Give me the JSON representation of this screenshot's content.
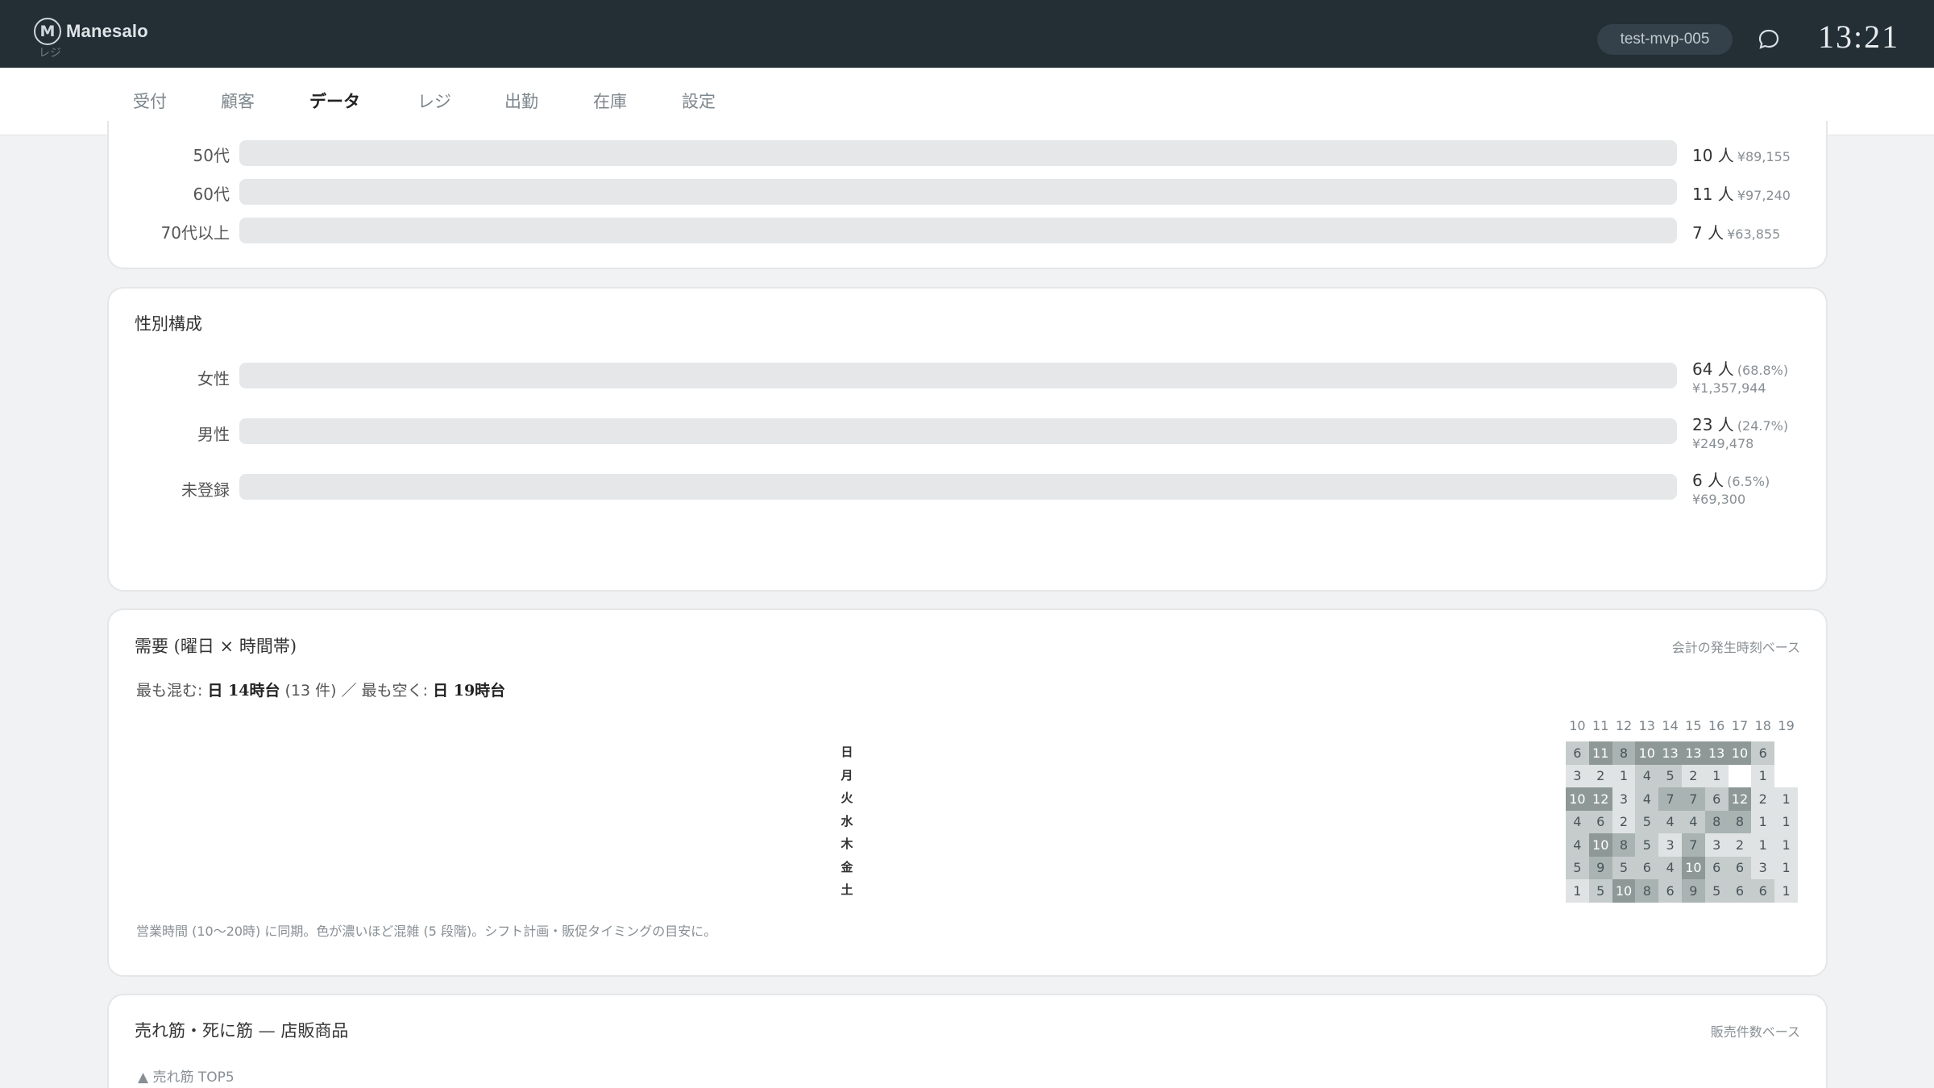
{
  "header": {
    "logo_glyph": "M",
    "app_name": "Manesalo",
    "app_sub": "レジ",
    "account": "test-mvp-005",
    "time": "13:21"
  },
  "tabs": [
    {
      "label": "受付"
    },
    {
      "label": "顧客"
    },
    {
      "label": "データ",
      "active": true
    },
    {
      "label": "レジ"
    },
    {
      "label": "出勤"
    },
    {
      "label": "在庫"
    },
    {
      "label": "設定"
    }
  ],
  "age": {
    "rows": [
      {
        "label": "50代",
        "count": "10 人",
        "amount": "¥89,155"
      },
      {
        "label": "60代",
        "count": "11 人",
        "amount": "¥97,240"
      },
      {
        "label": "70代以上",
        "count": "7 人",
        "amount": "¥63,855"
      }
    ]
  },
  "gender": {
    "title": "性別構成",
    "rows": [
      {
        "label": "女性",
        "count": "64 人",
        "pct": "(68.8%)",
        "amount": "¥1,357,944"
      },
      {
        "label": "男性",
        "count": "23 人",
        "pct": "(24.7%)",
        "amount": "¥249,478"
      },
      {
        "label": "未登録",
        "count": "6 人",
        "pct": "(6.5%)",
        "amount": "¥69,300"
      }
    ]
  },
  "demand": {
    "title": "需要 (曜日 × 時間帯)",
    "note": "会計の発生時刻ベース",
    "summary_busy_label": "最も混む: ",
    "summary_busy_value": "日 14時台",
    "summary_busy_count": " (13 件) ／ 最も空く: ",
    "summary_quiet_value": "日 19時台",
    "footnote": "営業時間 (10〜20時) に同期。色が濃いほど混雑 (5 段階)。シフト計画・販促タイミングの目安に。",
    "hours": [
      "10",
      "11",
      "12",
      "13",
      "14",
      "15",
      "16",
      "17",
      "18",
      "19"
    ],
    "days": [
      "日",
      "月",
      "火",
      "水",
      "木",
      "金",
      "土"
    ],
    "matrix": [
      [
        6,
        11,
        8,
        10,
        13,
        13,
        13,
        10,
        6,
        null
      ],
      [
        3,
        2,
        1,
        4,
        5,
        2,
        1,
        null,
        1,
        null
      ],
      [
        10,
        12,
        3,
        4,
        7,
        7,
        6,
        12,
        2,
        1
      ],
      [
        4,
        6,
        2,
        5,
        4,
        4,
        8,
        8,
        1,
        1
      ],
      [
        4,
        10,
        8,
        5,
        3,
        7,
        3,
        2,
        1,
        1
      ],
      [
        5,
        9,
        5,
        6,
        4,
        10,
        6,
        6,
        3,
        1
      ],
      [
        1,
        5,
        10,
        8,
        6,
        9,
        5,
        6,
        6,
        1
      ]
    ]
  },
  "products": {
    "title": "売れ筋・死に筋 — 店販商品",
    "note": "販売件数ベース",
    "top_label": "▲ 売れ筋 TOP5"
  },
  "colors": {
    "topbar": "#232e35",
    "heat_levels": [
      "#ffffff",
      "#dfe3e3",
      "#c5cccb",
      "#a9b3b1",
      "#8e9997"
    ]
  }
}
